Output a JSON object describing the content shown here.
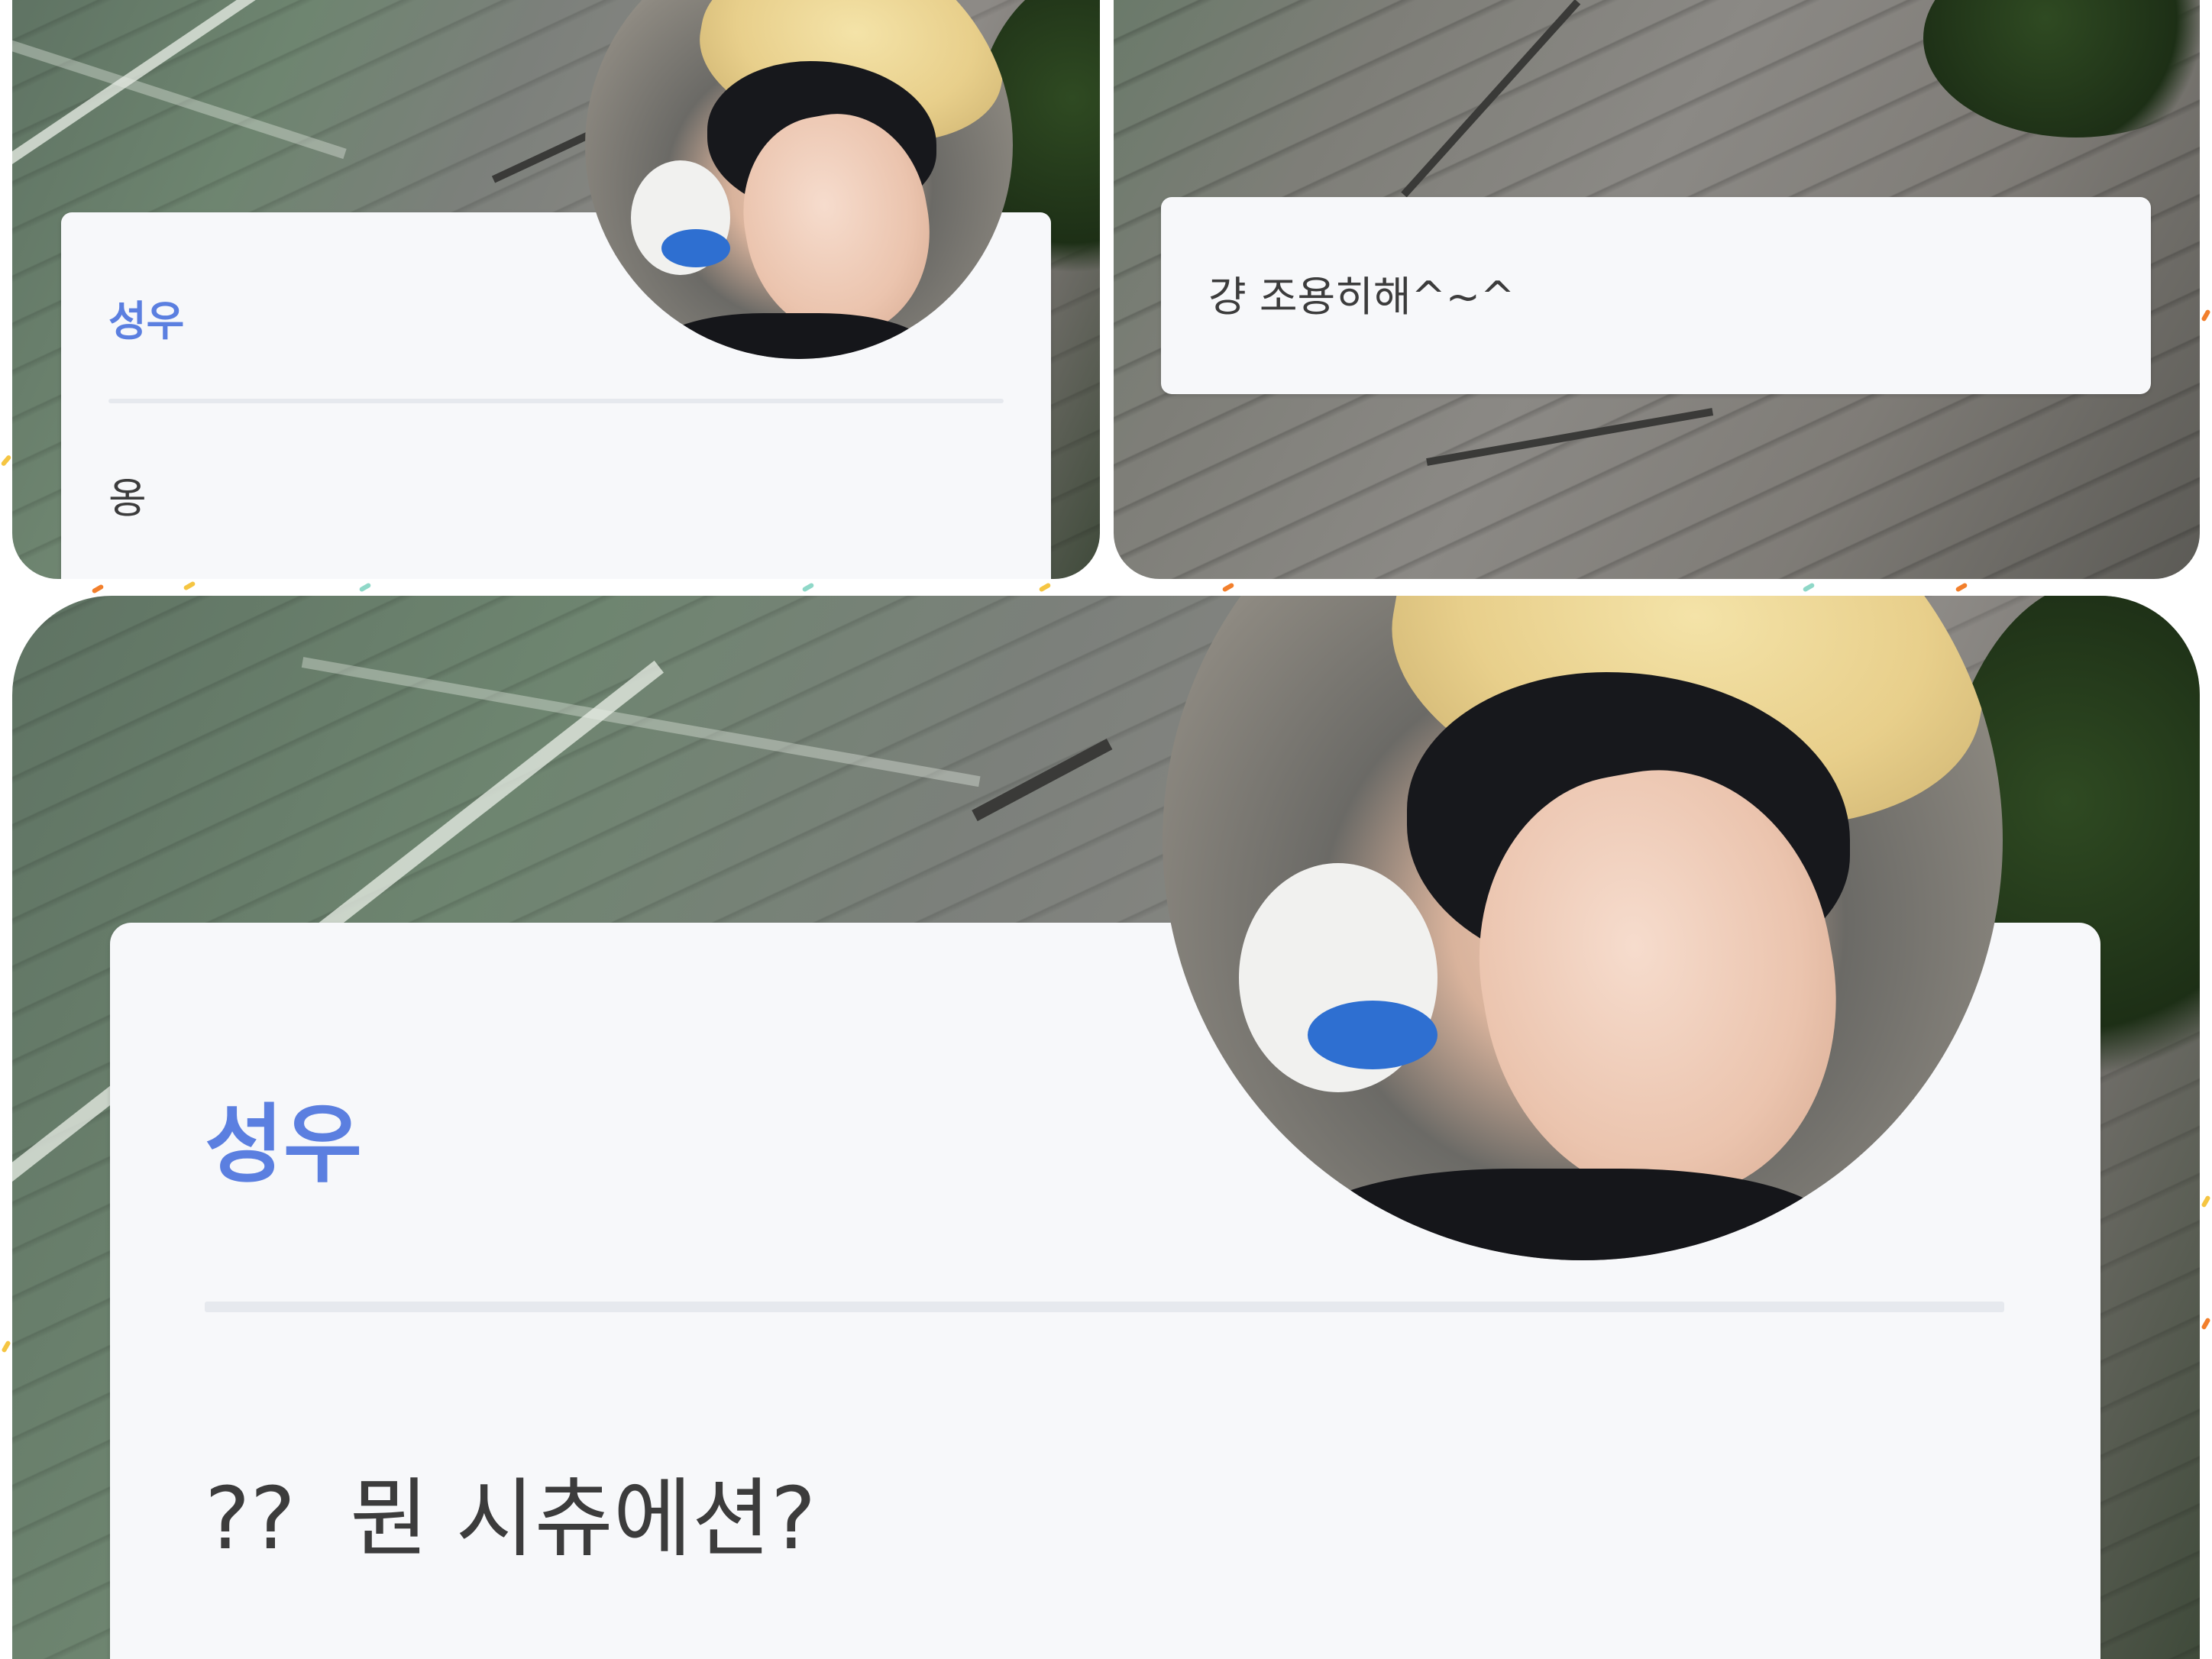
{
  "colors": {
    "name_accent": "#5b7fe0",
    "card_background": "#f7f8fa",
    "message_text": "#3c3c3c",
    "divider": "#e6e9ee"
  },
  "panels": [
    {
      "sender_name": "성우",
      "message": "옹",
      "has_avatar": true,
      "avatar_icon": "profile-photo-with-duck-hat"
    },
    {
      "message": "걍 조용히해^~^",
      "has_avatar": false
    },
    {
      "sender_name": "성우",
      "message": "??  뭔 시츄에션?",
      "has_avatar": true,
      "avatar_icon": "profile-photo-with-duck-hat"
    }
  ]
}
